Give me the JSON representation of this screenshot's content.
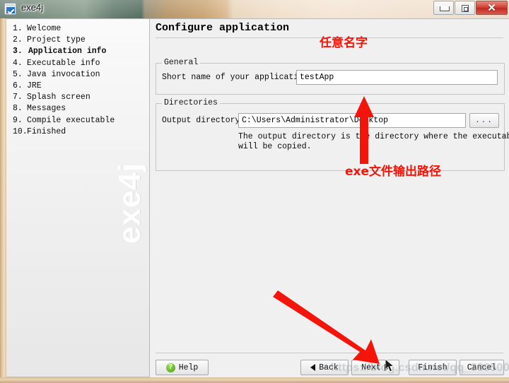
{
  "window": {
    "title": "exe4j",
    "icon": "exe4j-app-icon",
    "controls": {
      "minimize": "minimize-icon",
      "maximize": "maximize-icon",
      "close": "✕"
    }
  },
  "sidebar": {
    "watermark": "exe4j",
    "steps": [
      {
        "num": "1.",
        "label": "Welcome",
        "active": false
      },
      {
        "num": "2.",
        "label": "Project type",
        "active": false
      },
      {
        "num": "3.",
        "label": "Application info",
        "active": true
      },
      {
        "num": "4.",
        "label": "Executable info",
        "active": false
      },
      {
        "num": "5.",
        "label": "Java invocation",
        "active": false
      },
      {
        "num": "6.",
        "label": "JRE",
        "active": false
      },
      {
        "num": "7.",
        "label": "Splash screen",
        "active": false
      },
      {
        "num": "8.",
        "label": "Messages",
        "active": false
      },
      {
        "num": "9.",
        "label": "Compile executable",
        "active": false
      },
      {
        "num": "10.",
        "label": "Finished",
        "active": false
      }
    ]
  },
  "main": {
    "title": "Configure application",
    "general": {
      "group_title": "General",
      "short_name_label": "Short name of your application:",
      "short_name_value": "testApp"
    },
    "directories": {
      "group_title": "Directories",
      "output_label": "Output directory:",
      "output_value": "C:\\Users\\Administrator\\Desktop",
      "browse_label": "...",
      "hint": "The output directory is the directory where the executable\nwill be copied."
    }
  },
  "buttons": {
    "help": "Help",
    "back": "Back",
    "next": "Next",
    "finish": "Finish",
    "cancel": "Cancel"
  },
  "annotations": {
    "name_note": "任意名字",
    "path_note": "exe文件输出路径",
    "color": "#f41409"
  },
  "watermark": {
    "url": "https://blog.csdn.net/qq_38950013"
  }
}
